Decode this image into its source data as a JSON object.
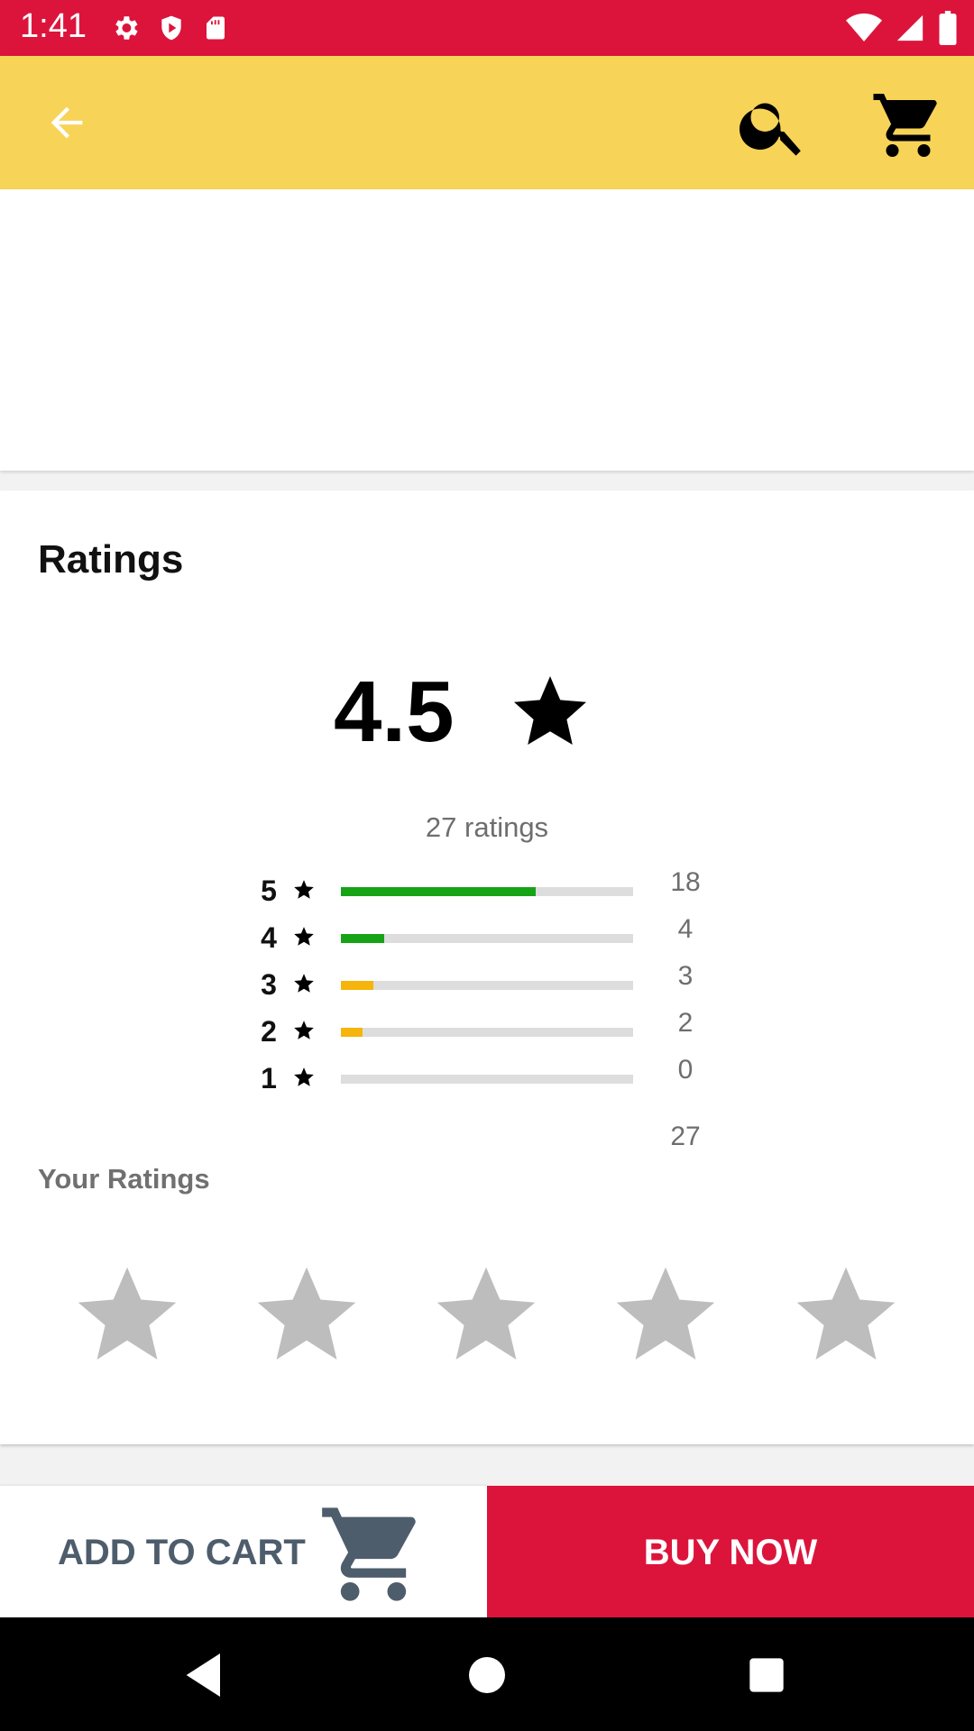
{
  "status_bar": {
    "time": "1:41",
    "left_icons": [
      "settings-icon",
      "shield-icon",
      "sd-card-icon"
    ],
    "right_icons": [
      "wifi-icon",
      "cell-signal-icon",
      "battery-icon"
    ],
    "background": "#dc143c"
  },
  "app_bar": {
    "background": "#f7d358",
    "icons": [
      "back-arrow-icon",
      "search-icon",
      "cart-icon"
    ]
  },
  "ratings": {
    "title": "Ratings",
    "average": "4.5",
    "count_label": "27 ratings",
    "total": "27",
    "distribution": [
      {
        "stars": "5",
        "count": "18",
        "fraction": 0.6667,
        "color": "#16a316"
      },
      {
        "stars": "4",
        "count": "4",
        "fraction": 0.1481,
        "color": "#16a316"
      },
      {
        "stars": "3",
        "count": "3",
        "fraction": 0.1111,
        "color": "#f5b50c"
      },
      {
        "stars": "2",
        "count": "2",
        "fraction": 0.0741,
        "color": "#f5b50c"
      },
      {
        "stars": "1",
        "count": "0",
        "fraction": 0,
        "color": "#f5b50c"
      }
    ]
  },
  "your_ratings": {
    "label": "Your Ratings",
    "selected": 0,
    "max": 5,
    "empty_star_color": "#bdbdbd"
  },
  "bottom_bar": {
    "add_to_cart": "ADD TO CART",
    "buy_now": "BUY NOW",
    "buy_now_color": "#dc143c",
    "add_to_cart_color": "#4e5d6c"
  },
  "nav_bar": {
    "icons": [
      "back-triangle-icon",
      "home-circle-icon",
      "recents-square-icon"
    ]
  }
}
